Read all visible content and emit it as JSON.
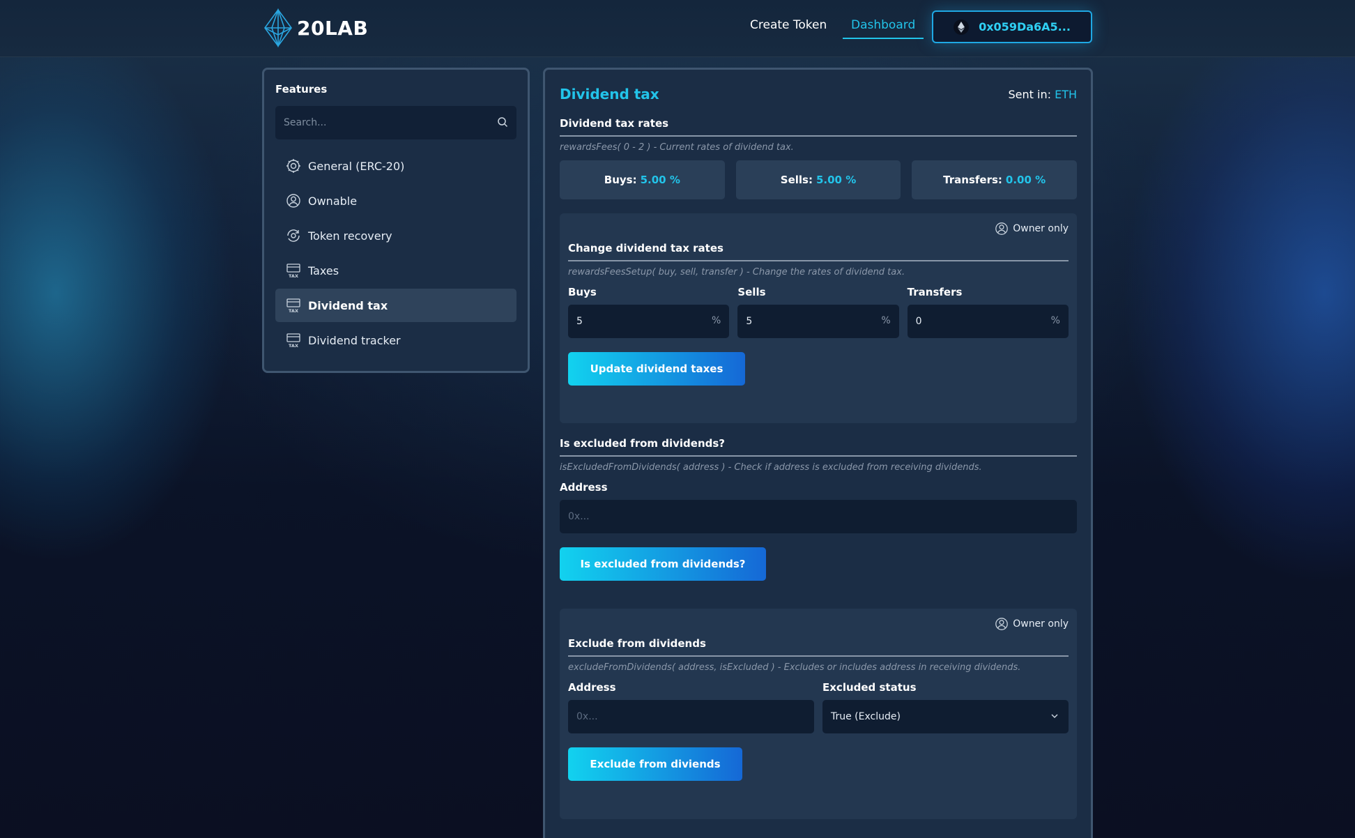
{
  "header": {
    "logo_text": "20LAB",
    "nav": {
      "create_token": "Create Token",
      "dashboard": "Dashboard"
    },
    "wallet_address": "0x059Da6A5..."
  },
  "sidebar": {
    "title": "Features",
    "search_placeholder": "Search...",
    "items": [
      {
        "label": "General (ERC-20)",
        "icon": "gear-icon",
        "active": false
      },
      {
        "label": "Ownable",
        "icon": "user-circle-icon",
        "active": false
      },
      {
        "label": "Token recovery",
        "icon": "recovery-icon",
        "active": false
      },
      {
        "label": "Taxes",
        "icon": "tax-icon",
        "active": false
      },
      {
        "label": "Dividend tax",
        "icon": "tax-icon",
        "active": true
      },
      {
        "label": "Dividend tracker",
        "icon": "tax-icon",
        "active": false
      }
    ]
  },
  "main": {
    "title": "Dividend tax",
    "sent_in_label": "Sent in:",
    "sent_in_value": "ETH",
    "rates_section": {
      "title": "Dividend tax rates",
      "desc": "rewardsFees( 0 - 2 ) - Current rates of dividend tax.",
      "buys_label": "Buys:",
      "buys_value": "5.00 %",
      "sells_label": "Sells:",
      "sells_value": "5.00 %",
      "transfers_label": "Transfers:",
      "transfers_value": "0.00 %"
    },
    "change_section": {
      "owner_label": "Owner only",
      "title": "Change dividend tax rates",
      "desc": "rewardsFeesSetup( buy, sell, transfer ) - Change the rates of dividend tax.",
      "buys_label": "Buys",
      "buys_value": "5",
      "sells_label": "Sells",
      "sells_value": "5",
      "transfers_label": "Transfers",
      "transfers_value": "0",
      "suffix": "%",
      "button": "Update dividend taxes"
    },
    "excluded_check": {
      "title": "Is excluded from dividends?",
      "desc": "isExcludedFromDividends( address ) - Check if address is excluded from receiving dividends.",
      "address_label": "Address",
      "address_placeholder": "0x...",
      "button": "Is excluded from dividends?"
    },
    "exclude_section": {
      "owner_label": "Owner only",
      "title": "Exclude from dividends",
      "desc": "excludeFromDividends( address, isExcluded ) - Excludes or includes address in receiving dividends.",
      "address_label": "Address",
      "address_placeholder": "0x...",
      "status_label": "Excluded status",
      "status_value": "True (Exclude)",
      "button": "Exclude from diviends"
    }
  },
  "colors": {
    "accent": "#22c4ea",
    "panel": "#1b2d45",
    "card": "#233750"
  }
}
